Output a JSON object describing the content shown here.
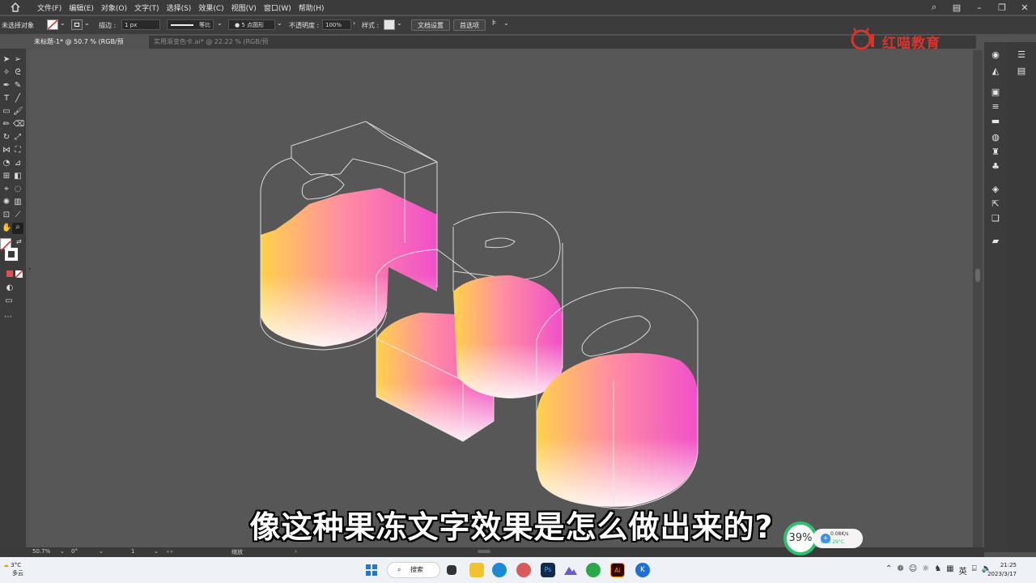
{
  "menubar": {
    "menus": [
      "文件(F)",
      "编辑(E)",
      "对象(O)",
      "文字(T)",
      "选择(S)",
      "效果(C)",
      "视图(V)",
      "窗口(W)",
      "帮助(H)"
    ]
  },
  "controlbar": {
    "selection_label": "未选择对象",
    "stroke_label": "描边 :",
    "stroke_value": "1 px",
    "profile_label": "等比",
    "brush_label": "5 点圆形",
    "opacity_label": "不透明度 :",
    "opacity_value": "100%",
    "style_label": "样式 :",
    "doc_setup_button": "文档设置",
    "preferences_button": "首选项"
  },
  "tabs": [
    {
      "label": "未标题-1* @ 50.7 % (RGB/预览)",
      "close": "×"
    },
    {
      "label": "实用渐变色卡.ai* @ 22.22 % (RGB/预览)",
      "close": "×"
    }
  ],
  "logo": {
    "text": "红喵教育"
  },
  "artwork": {
    "digits": [
      "5",
      "2",
      "0"
    ]
  },
  "subtitle": "像这种果冻文字效果是怎么做出来的?",
  "statusbar": {
    "zoom": "50.7%",
    "angle": "0°",
    "artboard": "1",
    "tool": "缩放"
  },
  "perf": {
    "cpu_percent": "39%",
    "net_speed": "0.08K/s",
    "cpu_temp": "CPU 29°C"
  },
  "taskbar": {
    "weather_temp": "3°C",
    "weather_desc": "多云",
    "search_label": "搜索",
    "ime": "英",
    "time": "21:25",
    "date": "2023/3/17"
  },
  "colors": {
    "accent": "#d9342c",
    "canvas": "#575757",
    "jelly_start": "#ffd24a",
    "jelly_mid": "#ff8fa0",
    "jelly_end": "#f050c8"
  }
}
